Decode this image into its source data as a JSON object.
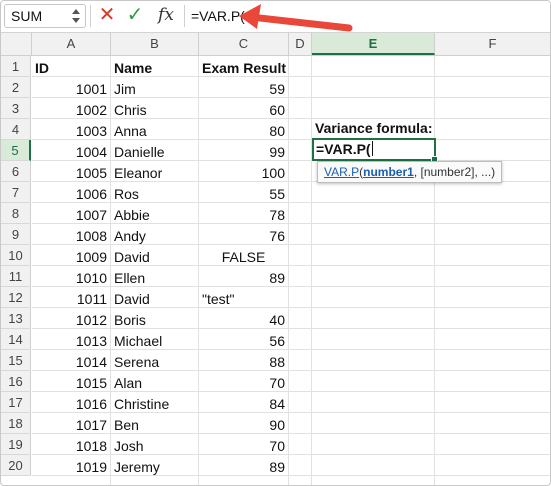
{
  "formula_bar": {
    "name_box": "SUM",
    "formula": "=VAR.P(",
    "cancel_glyph": "✕",
    "enter_glyph": "✓",
    "fx_glyph": "fx"
  },
  "columns": [
    "A",
    "B",
    "C",
    "D",
    "E",
    "F"
  ],
  "selected_column": "E",
  "rows": [
    "1",
    "2",
    "3",
    "4",
    "5",
    "6",
    "7",
    "8",
    "9",
    "10",
    "11",
    "12",
    "13",
    "14",
    "15",
    "16",
    "17",
    "18",
    "19",
    "20"
  ],
  "selected_row": "5",
  "headers": {
    "id": "ID",
    "name": "Name",
    "result": "Exam Result"
  },
  "records": [
    {
      "id": "1001",
      "name": "Jim",
      "result": "59"
    },
    {
      "id": "1002",
      "name": "Chris",
      "result": "60"
    },
    {
      "id": "1003",
      "name": "Anna",
      "result": "80"
    },
    {
      "id": "1004",
      "name": "Danielle",
      "result": "99"
    },
    {
      "id": "1005",
      "name": "Eleanor",
      "result": "100"
    },
    {
      "id": "1006",
      "name": "Ros",
      "result": "55"
    },
    {
      "id": "1007",
      "name": "Abbie",
      "result": "78"
    },
    {
      "id": "1008",
      "name": "Andy",
      "result": "76"
    },
    {
      "id": "1009",
      "name": "David",
      "result": "FALSE"
    },
    {
      "id": "1010",
      "name": "Ellen",
      "result": "89"
    },
    {
      "id": "1011",
      "name": "David",
      "result": "\"test\""
    },
    {
      "id": "1012",
      "name": "Boris",
      "result": "40"
    },
    {
      "id": "1013",
      "name": "Michael",
      "result": "56"
    },
    {
      "id": "1014",
      "name": "Serena",
      "result": "88"
    },
    {
      "id": "1015",
      "name": "Alan",
      "result": "70"
    },
    {
      "id": "1016",
      "name": "Christine",
      "result": "84"
    },
    {
      "id": "1017",
      "name": "Ben",
      "result": "90"
    },
    {
      "id": "1018",
      "name": "Josh",
      "result": "70"
    },
    {
      "id": "1019",
      "name": "Jeremy",
      "result": "89"
    }
  ],
  "variance_label": "Variance formula:",
  "active_cell_text": "=VAR.P(",
  "tooltip": {
    "fn": "VAR.P",
    "open": "(",
    "arg1": "number1",
    "rest": ", [number2], ...)"
  },
  "colors": {
    "accent_green": "#1e7145",
    "arrow_red": "#e8473a",
    "link_blue": "#1a5fb4"
  }
}
